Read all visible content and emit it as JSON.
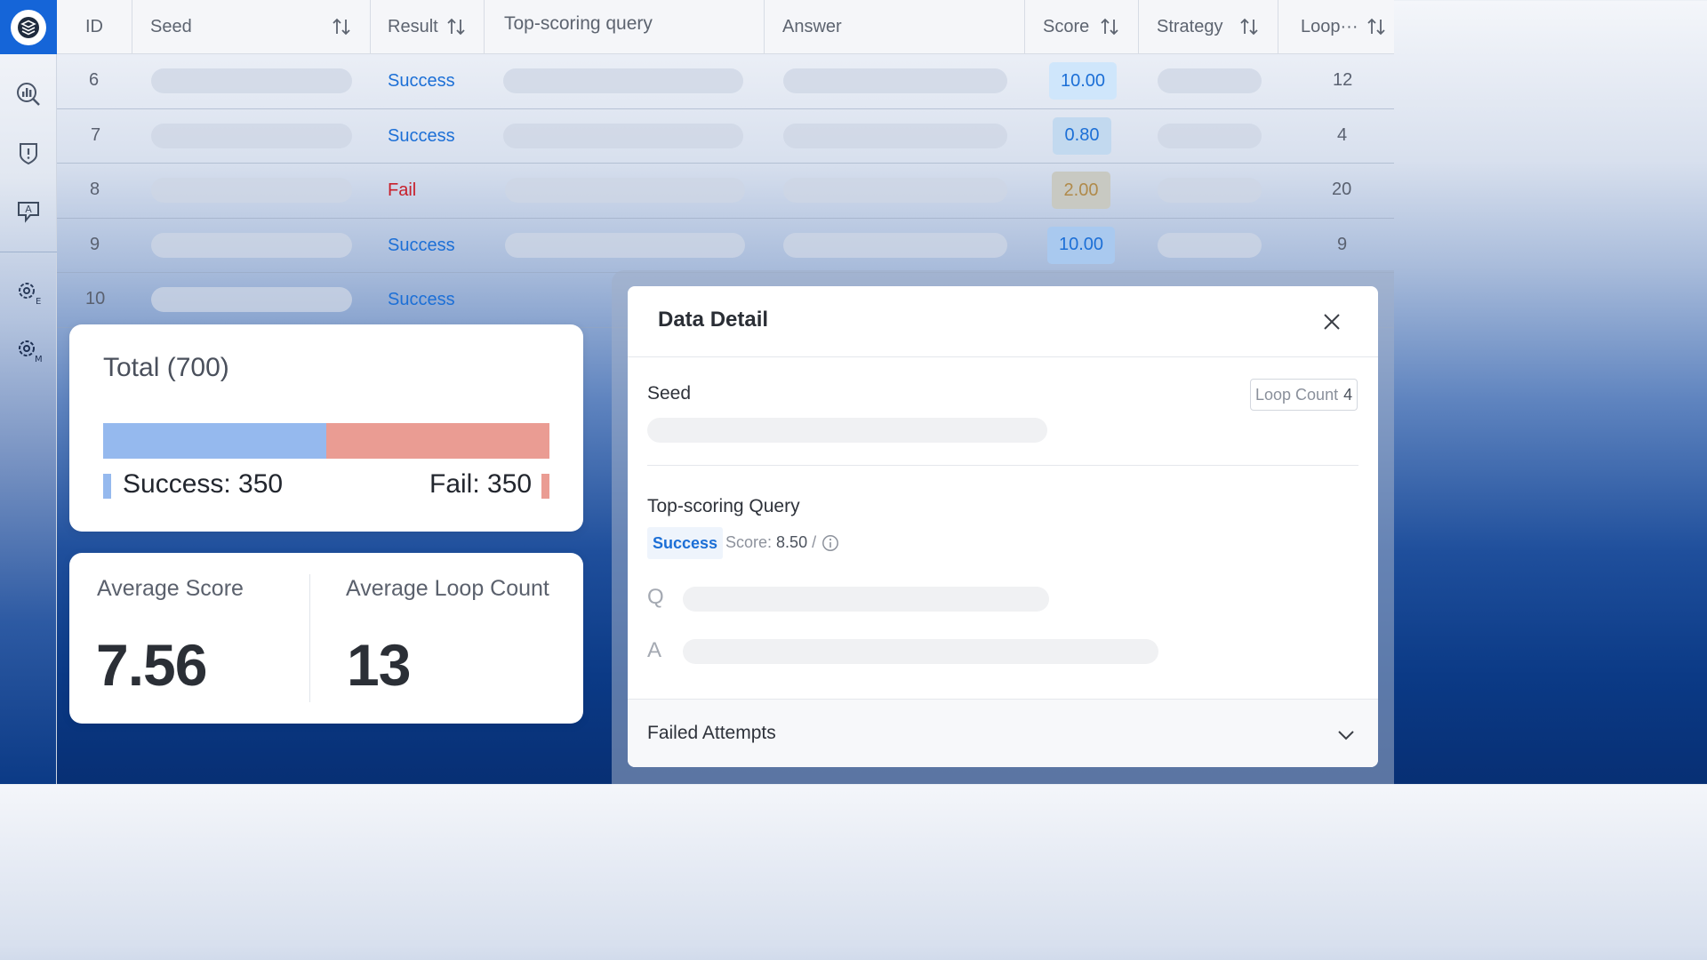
{
  "table": {
    "columns": [
      {
        "key": "id",
        "label": "ID",
        "sortable": false
      },
      {
        "key": "seed",
        "label": "Seed",
        "sortable": true
      },
      {
        "key": "result",
        "label": "Result",
        "sortable": true
      },
      {
        "key": "query",
        "label": "Top-scoring query",
        "sortable": false
      },
      {
        "key": "answer",
        "label": "Answer",
        "sortable": false
      },
      {
        "key": "score",
        "label": "Score",
        "sortable": true
      },
      {
        "key": "strategy",
        "label": "Strategy",
        "sortable": true
      },
      {
        "key": "loop",
        "label": "Loop···",
        "sortable": true
      }
    ],
    "rows": [
      {
        "id": "6",
        "result": "Success",
        "score": "10.00",
        "loop": "12"
      },
      {
        "id": "7",
        "result": "Success",
        "score": "0.80",
        "loop": "4"
      },
      {
        "id": "8",
        "result": "Fail",
        "score": "2.00",
        "loop": "20"
      },
      {
        "id": "9",
        "result": "Success",
        "score": "10.00",
        "loop": "9"
      },
      {
        "id": "10",
        "result": "Success",
        "score": "",
        "loop": ""
      }
    ]
  },
  "total_card": {
    "title": "Total (700)",
    "success_label": "Success: 350",
    "fail_label": "Fail: 350",
    "success_count": 350,
    "fail_count": 350,
    "success_color": "#95b9ee",
    "fail_color": "#ea9c93"
  },
  "metrics_card": {
    "avg_score_label": "Average Score",
    "avg_score_value": "7.56",
    "avg_loop_label": "Average Loop Count",
    "avg_loop_value": "13"
  },
  "detail": {
    "title": "Data Detail",
    "seed_label": "Seed",
    "loop_count_label": "Loop Count",
    "loop_count_value": "4",
    "query_section_label": "Top-scoring Query",
    "status_tag": "Success",
    "score_prefix": "Score:",
    "score_value": "8.50",
    "score_suffix": "/",
    "q_letter": "Q",
    "a_letter": "A",
    "failed_attempts_label": "Failed Attempts"
  },
  "colors": {
    "accent": "#1565d8",
    "success_text": "#1c6fd6",
    "fail_text": "#c8202c"
  },
  "icons": [
    "logo-icon",
    "analytics-icon",
    "shield-alert-icon",
    "translate-icon",
    "settings-e-icon",
    "settings-m-icon",
    "sort-icon",
    "close-icon",
    "info-icon",
    "chevron-down-icon"
  ]
}
